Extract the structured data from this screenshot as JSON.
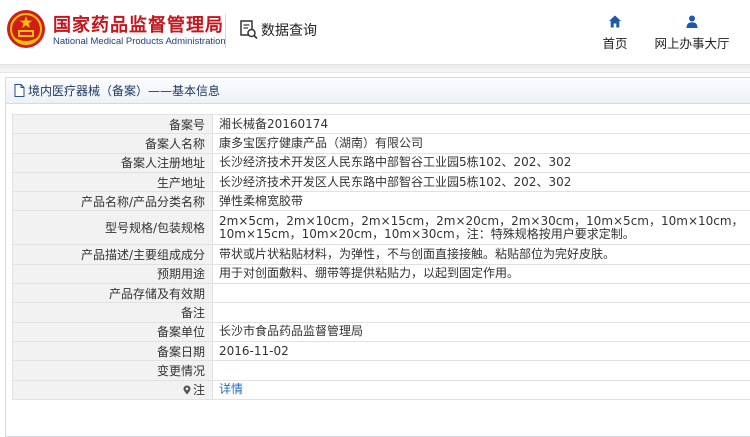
{
  "header": {
    "site_name_cn": "国家药品监督管理局",
    "site_name_en": "National Medical Products Administration",
    "query_label": "数据查询",
    "nav": [
      {
        "label": "首页",
        "icon": "home-icon"
      },
      {
        "label": "网上办事大厅",
        "icon": "person-icon"
      }
    ]
  },
  "panel": {
    "title": "境内医疗器械（备案）——基本信息",
    "title_icon": "document-icon"
  },
  "records": [
    {
      "label": "备案号",
      "value": "湘长械备20160174"
    },
    {
      "label": "备案人名称",
      "value": "康多宝医疗健康产品（湖南）有限公司"
    },
    {
      "label": "备案人注册地址",
      "value": "长沙经济技术开发区人民东路中部智谷工业园5栋102、202、302"
    },
    {
      "label": "生产地址",
      "value": "长沙经济技术开发区人民东路中部智谷工业园5栋102、202、302"
    },
    {
      "label": "产品名称/产品分类名称",
      "value": "弹性柔棉宽胶带"
    },
    {
      "label": "型号规格/包装规格",
      "value": "2m×5cm，2m×10cm，2m×15cm，2m×20cm，2m×30cm，10m×5cm，10m×10cm，10m×15cm，10m×20cm，10m×30cm，注：特殊规格按用户要求定制。"
    },
    {
      "label": "产品描述/主要组成成分",
      "value": "带状或片状粘贴材料，为弹性，不与创面直接接触。粘贴部位为完好皮肤。"
    },
    {
      "label": "预期用途",
      "value": "用于对创面敷料、绷带等提供粘贴力，以起到固定作用。"
    },
    {
      "label": "产品存储及有效期",
      "value": ""
    },
    {
      "label": "备注",
      "value": ""
    },
    {
      "label": "备案单位",
      "value": "长沙市食品药品监督管理局"
    },
    {
      "label": "备案日期",
      "value": "2016-11-02"
    },
    {
      "label": "变更情况",
      "value": ""
    },
    {
      "label": "注",
      "value": "详情",
      "icon": "pin-icon"
    }
  ],
  "colors": {
    "brand_red": "#c4161c",
    "brand_blue": "#1d3f8a",
    "nav_icon_blue": "#1e5aa8",
    "link_blue": "#2a6db8",
    "label_bg": "#f2f2f2"
  }
}
